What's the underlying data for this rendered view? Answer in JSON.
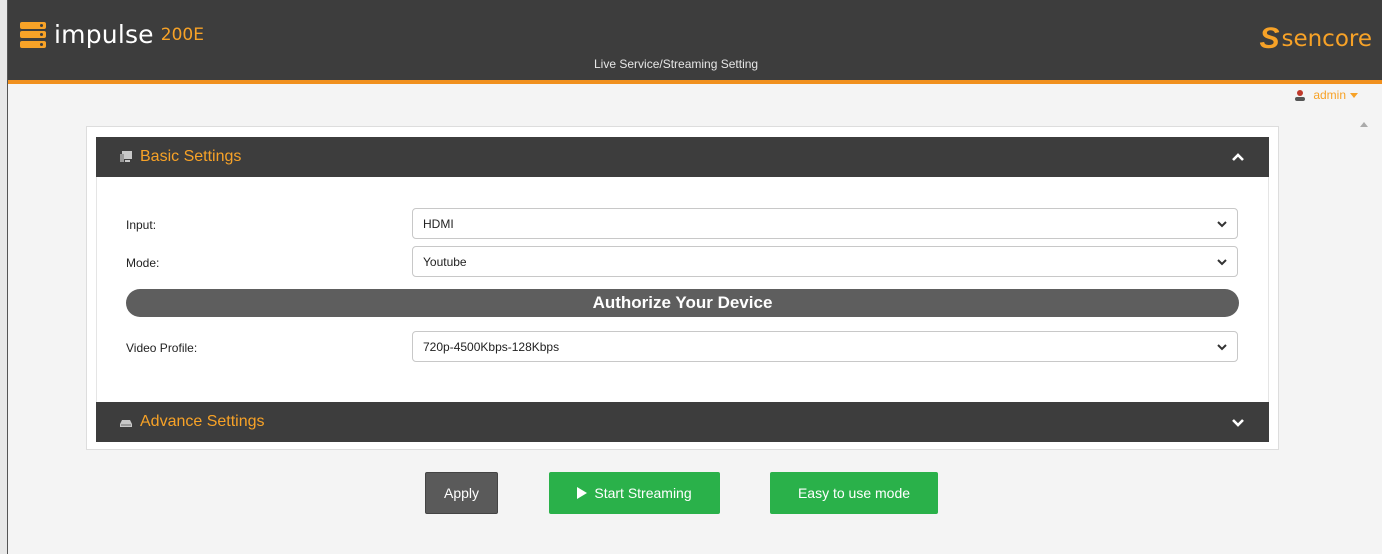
{
  "header": {
    "product_name": "impulse",
    "product_model": "200E",
    "page_subtitle": "Live Service/Streaming Setting",
    "brand_name": "sencore"
  },
  "user": {
    "name": "admin"
  },
  "basic_settings": {
    "title": "Basic Settings",
    "fields": {
      "input": {
        "label": "Input:",
        "value": "HDMI"
      },
      "mode": {
        "label": "Mode:",
        "value": "Youtube"
      },
      "video_profile": {
        "label": "Video Profile:",
        "value": "720p-4500Kbps-128Kbps"
      }
    },
    "authorize_label": "Authorize Your Device"
  },
  "advance_settings": {
    "title": "Advance Settings"
  },
  "buttons": {
    "apply": "Apply",
    "start_streaming": "Start Streaming",
    "easy_mode": "Easy to use mode"
  },
  "colors": {
    "header_bg": "#3d3d3d",
    "accent": "#f7a227",
    "start_green": "#2ab14a",
    "apply_gray": "#5a5a5a"
  },
  "icons": {
    "logo": "server-stack-icon",
    "brand": "sencore-s-icon",
    "user": "user-icon",
    "basic": "monitor-icon",
    "advance": "drive-icon",
    "collapse": "chevron-up-icon",
    "expand": "chevron-down-icon",
    "play": "play-icon"
  }
}
